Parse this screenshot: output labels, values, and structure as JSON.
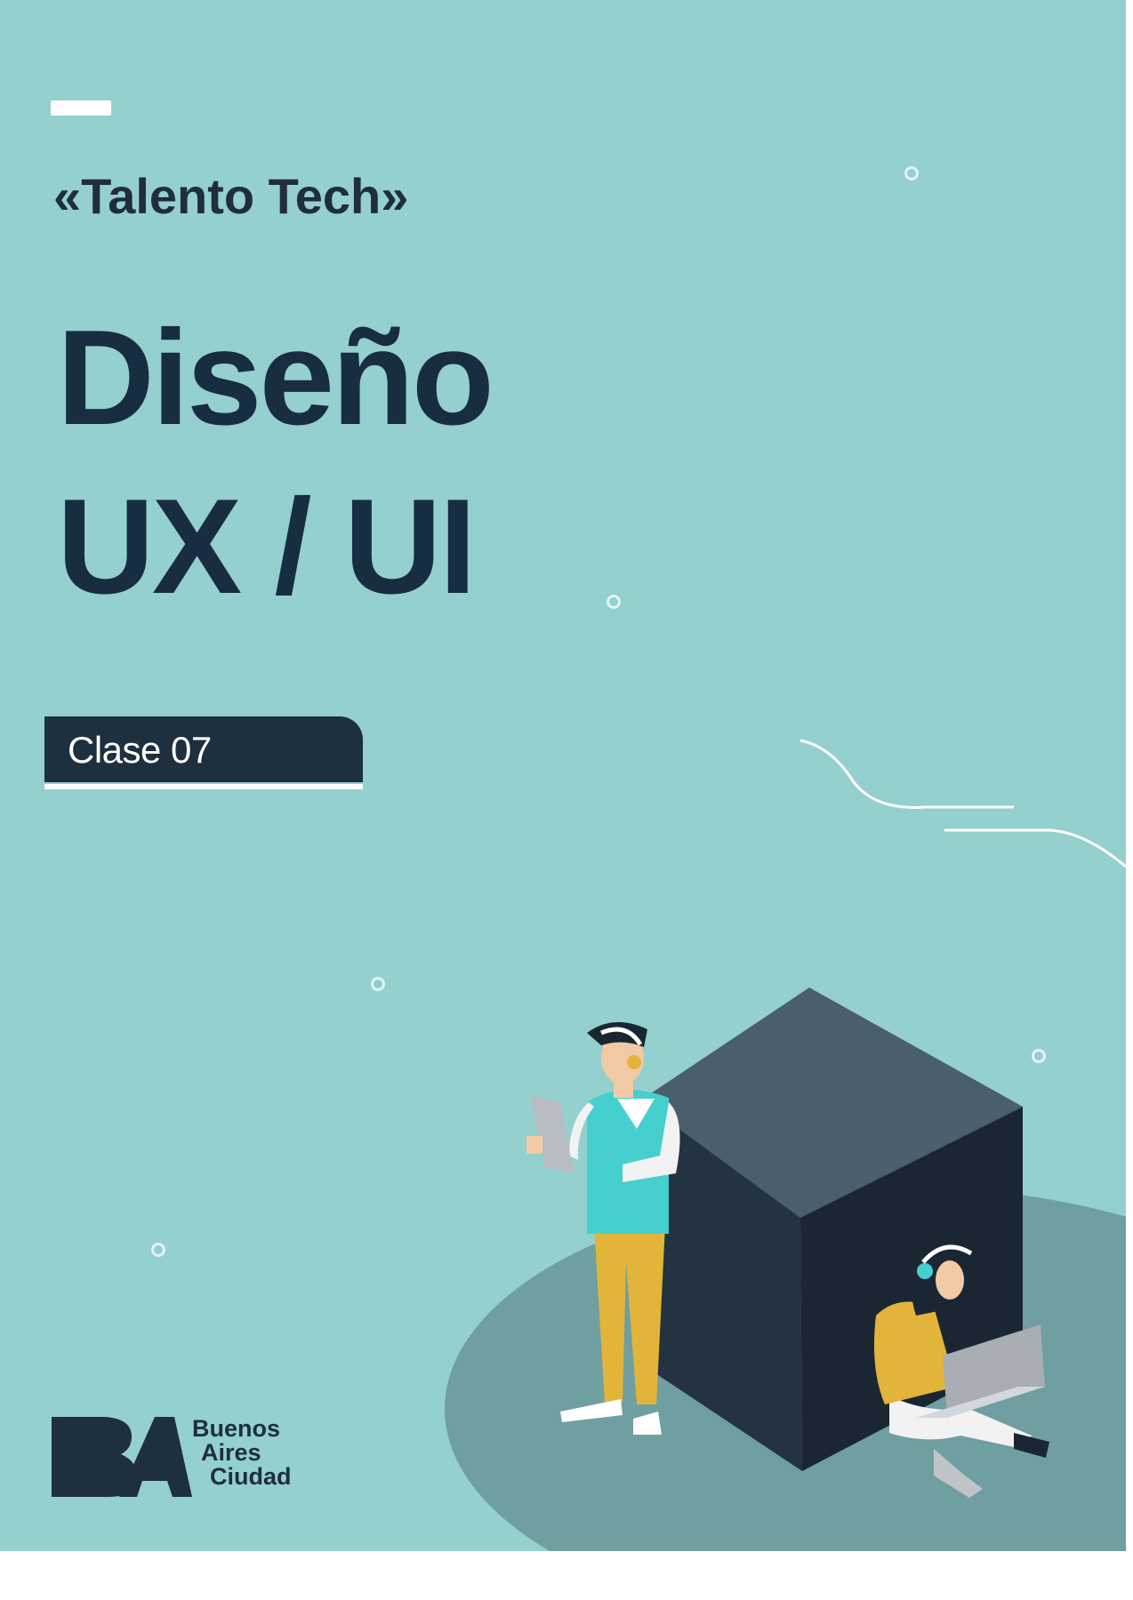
{
  "header": {
    "brand": "«Talento Tech»"
  },
  "title": {
    "line1": "Diseño",
    "line2": "UX / UI"
  },
  "class_tag": {
    "label": "Clase 07"
  },
  "logo": {
    "line1": "Buenos",
    "line2": "Aires",
    "line3": "Ciudad"
  },
  "colors": {
    "background": "#94d0cd",
    "text_dark": "#182c42",
    "tag_bg": "#1e2f3f",
    "accent_white": "#ffffff"
  },
  "icons": [
    "decorative-circle-icon",
    "ba-logo-icon",
    "people-illustration"
  ]
}
